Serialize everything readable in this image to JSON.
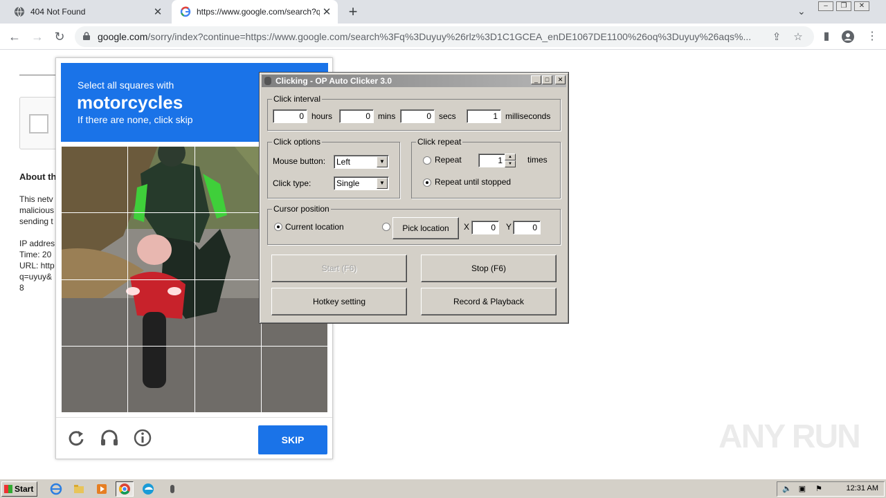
{
  "browser": {
    "tabs": [
      {
        "title": "404 Not Found"
      },
      {
        "title": "https://www.google.com/search?q="
      }
    ],
    "url_host": "google.com",
    "url_rest": "/sorry/index?continue=https://www.google.com/search%3Fq%3Duyuy%26rlz%3D1C1GCEA_enDE1067DE1100%26oq%3Duyuy%26aqs%..."
  },
  "page": {
    "about_heading": "About th",
    "para_lines": [
      "This netv",
      "malicious",
      "sending t"
    ],
    "info_lines": [
      "IP addres",
      "Time: 20",
      "URL: http",
      "q=uyuy&",
      "8"
    ]
  },
  "captcha": {
    "line1": "Select all squares with",
    "line2": "motorcycles",
    "line3": "If there are none, click skip",
    "skip_label": "SKIP"
  },
  "clicker": {
    "title": "Clicking - OP Auto Clicker 3.0",
    "interval": {
      "label": "Click interval",
      "hours": "0",
      "hours_label": "hours",
      "mins": "0",
      "mins_label": "mins",
      "secs": "0",
      "secs_label": "secs",
      "ms": "1",
      "ms_label": "milliseconds"
    },
    "options": {
      "label": "Click options",
      "mouse_label": "Mouse button:",
      "mouse_value": "Left",
      "type_label": "Click type:",
      "type_value": "Single"
    },
    "repeat": {
      "label": "Click repeat",
      "repeat_label": "Repeat",
      "repeat_count": "1",
      "times_label": "times",
      "until_label": "Repeat until stopped"
    },
    "cursor": {
      "label": "Cursor position",
      "current_label": "Current location",
      "pick_label": "Pick location",
      "x_label": "X",
      "x_value": "0",
      "y_label": "Y",
      "y_value": "0"
    },
    "buttons": {
      "start": "Start (F6)",
      "stop": "Stop (F6)",
      "hotkey": "Hotkey setting",
      "record": "Record & Playback"
    }
  },
  "watermark": "ANY RUN",
  "taskbar": {
    "start_label": "Start",
    "clock": "12:31 AM"
  },
  "colors": {
    "accent_blue": "#1a73e8",
    "win_face": "#d4d0c8"
  }
}
